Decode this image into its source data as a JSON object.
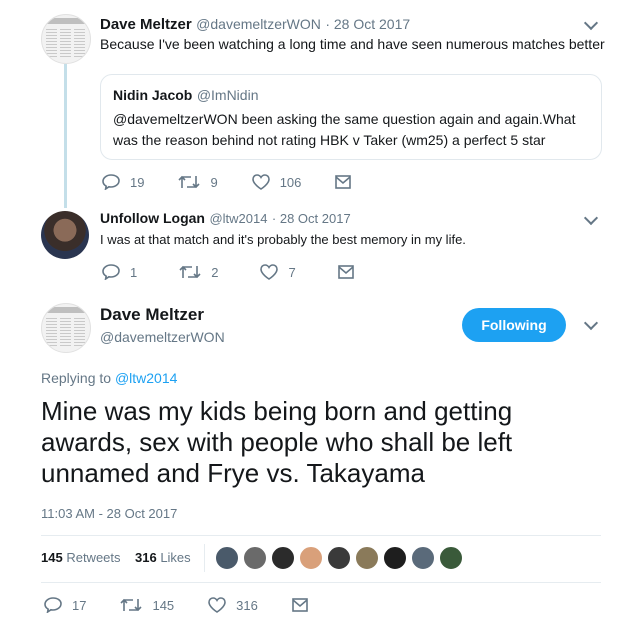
{
  "tweet1": {
    "name": "Dave Meltzer",
    "handle": "@davemeltzerWON",
    "date": "· 28 Oct 2017",
    "text": "Because I've been watching a long time and have seen numerous matches better",
    "quote": {
      "name": "Nidin Jacob",
      "handle": "@ImNidin",
      "text": "@davemeltzerWON been asking the same question again and again.What was the reason behind not rating HBK v Taker (wm25) a perfect 5 star"
    },
    "replies": "19",
    "retweets": "9",
    "likes": "106"
  },
  "tweet2": {
    "name": "Unfollow Logan",
    "handle": "@ltw2014",
    "date": "· 28 Oct 2017",
    "text": "I was at that match and it's probably the best memory in my life.",
    "replies": "1",
    "retweets": "2",
    "likes": "7"
  },
  "main": {
    "name": "Dave Meltzer",
    "handle": "@davemeltzerWON",
    "follow_label": "Following",
    "replying_prefix": "Replying to",
    "replying_to": "@ltw2014",
    "text": "Mine was my kids being born and getting awards, sex with people who shall be left unnamed and Frye vs. Takayama",
    "timestamp": "11:03 AM - 28 Oct 2017",
    "retweet_count": "145",
    "retweet_label": "Retweets",
    "like_count": "316",
    "like_label": "Likes",
    "replies": "17",
    "retweets": "145",
    "likes": "316"
  },
  "colors": {
    "accent": "#1da1f2",
    "muted": "#657786",
    "thread": "#c4dfe9"
  },
  "liker_avatars": [
    "#4a5a6a",
    "#6a6a6a",
    "#2b2b2b",
    "#d9a07a",
    "#3a3a3a",
    "#8a7a5a",
    "#1e1e1e",
    "#5a6a7a",
    "#3a5a3a"
  ]
}
